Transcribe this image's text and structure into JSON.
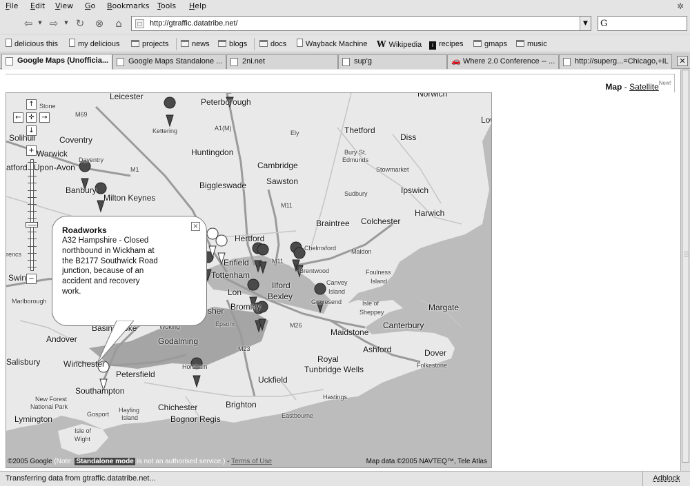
{
  "menu": [
    "File",
    "Edit",
    "View",
    "Go",
    "Bookmarks",
    "Tools",
    "Help"
  ],
  "nav": {
    "url": "http://gtraffic.datatribe.net/",
    "search_engine_icon": "G"
  },
  "bookmarks": [
    {
      "label": "delicious this",
      "icon": "page-icon"
    },
    {
      "label": "my delicious",
      "icon": "page-icon"
    },
    {
      "label": "projects",
      "icon": "folder-icon"
    },
    {
      "label": "news",
      "icon": "folder-icon"
    },
    {
      "label": "blogs",
      "icon": "folder-icon"
    },
    {
      "label": "docs",
      "icon": "folder-icon"
    },
    {
      "label": "Wayback Machine",
      "icon": "page-icon"
    },
    {
      "label": "Wikipedia",
      "icon": "wikipedia-icon",
      "glyph": "W"
    },
    {
      "label": "recipes",
      "icon": "recipes-icon",
      "glyph": "i"
    },
    {
      "label": "gmaps",
      "icon": "folder-icon"
    },
    {
      "label": "music",
      "icon": "folder-icon"
    }
  ],
  "tabs": [
    {
      "label": "Google Maps (Unofficia...",
      "active": true
    },
    {
      "label": "Google Maps Standalone ...",
      "active": false
    },
    {
      "label": "2ni.net",
      "active": false
    },
    {
      "label": "sup'g",
      "active": false
    },
    {
      "label": "Where 2.0 Conference -- ...",
      "active": false
    },
    {
      "label": "http://superg...=Chicago,+IL",
      "active": false
    }
  ],
  "map_header": {
    "map_label": "Map",
    "separator": " - ",
    "satellite_label": "Satellite",
    "new_badge": "New!"
  },
  "zoom": {
    "up": "↑",
    "left": "←",
    "center": "✛",
    "right": "→",
    "down": "↓",
    "in": "+",
    "out": "−",
    "level": 0.6
  },
  "places": {
    "leicester": "Leicester",
    "peterborough": "Peterborough",
    "norwich": "Norwich",
    "stone": "Stone",
    "kettering": "Kettering",
    "solihull": "Solihull",
    "warwick": "Warwick",
    "coventry": "Coventry",
    "ely": "Ely",
    "thetford": "Thetford",
    "diss": "Diss",
    "lowestoft": "Low",
    "huntingdon": "Huntingdon",
    "a1m": "A1(M)",
    "m69": "M69",
    "daventry": "Daventry",
    "stratford": "atford",
    "upon_avon": "Upon-Avon",
    "bury": "Bury St.",
    "edmunds": "Edmunds",
    "m1": "M1",
    "cambridge": "Cambridge",
    "stowmarket": "Stowmarket",
    "banbury": "Banbury",
    "biggleswade": "Biggleswade",
    "sawston": "Sawston",
    "ipswich": "Ipswich",
    "sudbury": "Sudbury",
    "milton_keynes": "Milton Keynes",
    "m11": "M11",
    "harwich": "Harwich",
    "braintree": "Braintree",
    "colchester": "Colchester",
    "hertford": "Hertford",
    "chelmsford": "Chelmsford",
    "rencs": "rencs",
    "enfield": "Enfield",
    "m11b": "M11",
    "brentwood": "Brentwood",
    "maldon": "Maldon",
    "swindon": "Swin",
    "tottenham": "Tottenham",
    "ilford": "Ilford",
    "foulness": "Foulness",
    "foulness2": "Island",
    "canvey": "Canvey",
    "canvey2": "Island",
    "marlborough": "Marlborough",
    "london": "Lon",
    "bexley": "Bexley",
    "gravesend": "Gravesend",
    "sheppey": "Isle of",
    "sheppey2": "Sheppey",
    "margate": "Margate",
    "bromley": "Bromley",
    "sher": "sher",
    "epsom": "Epsom",
    "m26": "M26",
    "basingstoke": "Basingstoke",
    "woking": "Woking",
    "andover": "Andover",
    "maidstone": "Maidstone",
    "canterbury": "Canterbury",
    "godalming": "Godalming",
    "ashford": "Ashford",
    "m23": "M23",
    "dover": "Dover",
    "salisbury": "Salisbury",
    "winchester": "Winchester",
    "royal": "Royal",
    "tunbridge": "Tunbridge Wells",
    "folkestone": "Folkestone",
    "petersfield": "Petersfield",
    "horsham": "Horsham",
    "uckfield": "Uckfield",
    "southampton": "Southampton",
    "hastings": "Hastings",
    "new_forest": "New Forest",
    "national_park": "National Park",
    "chichester": "Chichester",
    "brighton": "Brighton",
    "hayling": "Hayling",
    "hayling2": "Island",
    "lymington": "Lymington",
    "gosport": "Gosport",
    "bognor": "Bognor Regis",
    "eastbourne": "Eastbourne",
    "wight": "Isle of",
    "wight2": "Wight"
  },
  "info_window": {
    "title": "Roadworks",
    "body": "A32 Hampshire - Closed northbound in Wickham at the B2177 Southwick Road junction, because of an accident and recovery work.",
    "close": "×"
  },
  "map_footer": {
    "copyright": "©2005 Google",
    "note_open": " (Note: ",
    "standalone": "Standalone mode",
    "note_close": " is not an authorised service.)",
    "dash": " - ",
    "terms": "Terms of Use",
    "map_data": "Map data ©2005 NAVTEQ™, Tele Atlas"
  },
  "status": {
    "text": "Transferring data from gtraffic.datatribe.net...",
    "adblock": "Adblock"
  },
  "colors": {
    "land": "#e9e9e9",
    "sea": "#bcbcbc",
    "roads": "#9a9a9a",
    "minor_roads": "#c8c8c8",
    "traffic_shadow": "#6e6e6e",
    "marker": "#4a4a4a"
  }
}
